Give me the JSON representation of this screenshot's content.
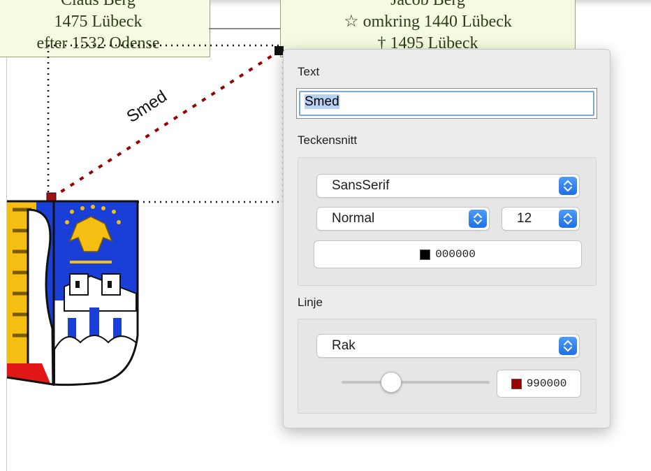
{
  "canvas": {
    "left_person": {
      "lines": [
        "Claus Berg",
        "1475 Lübeck",
        "efter 1532 Odense"
      ]
    },
    "right_person": {
      "lines": [
        "Jacob Berg",
        "☆ omkring 1440 Lübeck",
        "† 1495 Lübeck"
      ]
    },
    "relation_label": "Smed"
  },
  "popover": {
    "text_section": {
      "label": "Text",
      "value": "Smed"
    },
    "font_section": {
      "label": "Teckensnitt",
      "family": "SansSerif",
      "style": "Normal",
      "size": "12",
      "color_hex": "000000",
      "color": "#000000"
    },
    "line_section": {
      "label": "Linje",
      "line_type": "Rak",
      "thickness": 0.33,
      "color_hex": "990000",
      "color": "#990000"
    }
  },
  "colors": {
    "accent": "#2f7df6",
    "line_red": "#990000",
    "box_fill": "#f4fbe2",
    "coat_blue": "#1a3fd8",
    "coat_gold": "#f4be12"
  },
  "icons": {
    "stepper": "chevron-up-down-icon",
    "coat_of_arms": "coat-of-arms-icon"
  }
}
